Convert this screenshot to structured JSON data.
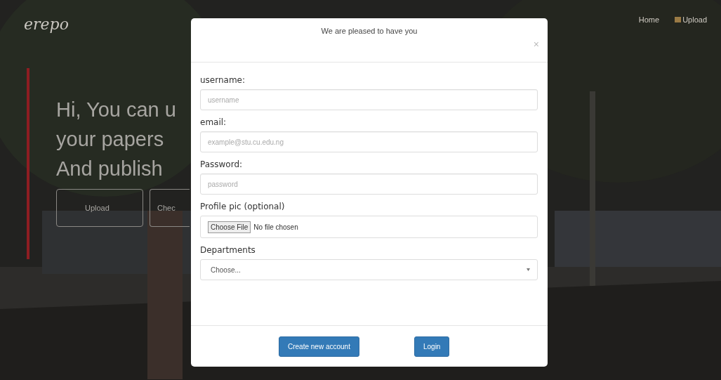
{
  "brand": "erepo",
  "nav": [
    {
      "label": "Home",
      "icon": false
    },
    {
      "label": "Upload",
      "icon": true
    }
  ],
  "hero": {
    "lines": [
      "Hi, You can u",
      "your papers",
      "And publish"
    ],
    "buttons": [
      "Upload",
      "Chec"
    ]
  },
  "modal": {
    "title": "We are pleased to have you",
    "close": "×",
    "fields": [
      {
        "kind": "text",
        "label": "username:",
        "placeholder": "username"
      },
      {
        "kind": "text",
        "label": "email:",
        "placeholder": "example@stu.cu.edu.ng"
      },
      {
        "kind": "text",
        "label": "Password:",
        "placeholder": "password"
      },
      {
        "kind": "file",
        "label": "Profile pic (optional)",
        "button": "Choose File",
        "status": "No file chosen"
      },
      {
        "kind": "select",
        "label": "Departments",
        "value": "Choose..."
      }
    ],
    "buttons": [
      "Create new account",
      "Login"
    ]
  }
}
